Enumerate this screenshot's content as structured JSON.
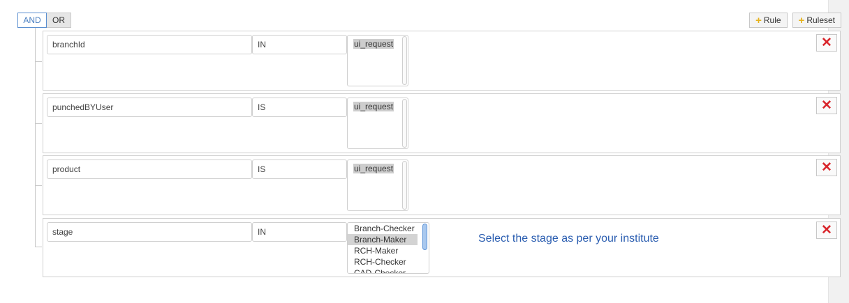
{
  "toolbar": {
    "and_label": "AND",
    "or_label": "OR",
    "add_rule_label": "Rule",
    "add_ruleset_label": "Ruleset"
  },
  "rules": [
    {
      "field": "branchId",
      "operator": "IN",
      "values": [
        "ui_request"
      ]
    },
    {
      "field": "punchedBYUser",
      "operator": "IS",
      "values": [
        "ui_request"
      ]
    },
    {
      "field": "product",
      "operator": "IS",
      "values": [
        "ui_request"
      ]
    },
    {
      "field": "stage",
      "operator": "IN",
      "values": [
        "Branch-Checker",
        "Branch-Maker",
        "RCH-Maker",
        "RCH-Checker",
        "CAD-Checker"
      ],
      "selected": "Branch-Maker",
      "hint": "Select the stage as per your institute"
    }
  ],
  "icons": {
    "add": "plus-icon",
    "delete": "close-icon"
  },
  "colors": {
    "accent": "#4a7fc1",
    "hint": "#2a5db0",
    "delete": "#d9262c",
    "plus": "#e6b21c"
  }
}
